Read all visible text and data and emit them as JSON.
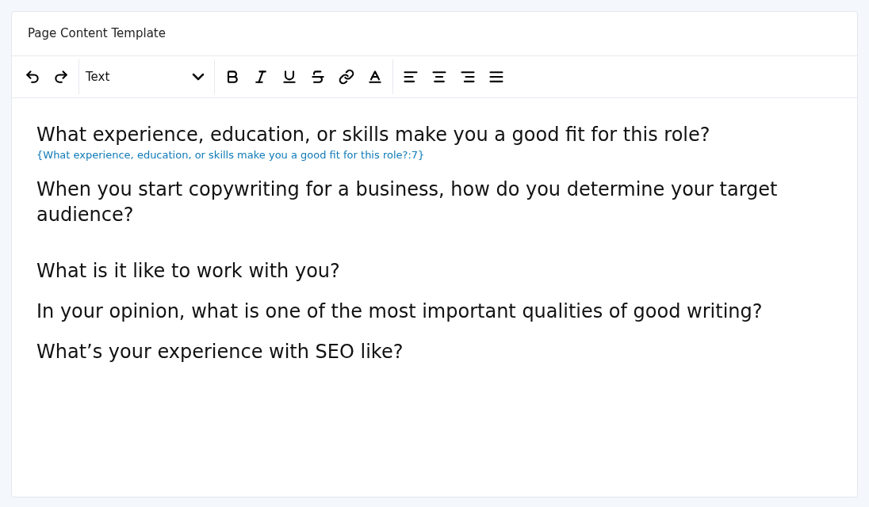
{
  "card": {
    "title": "Page Content Template"
  },
  "toolbar": {
    "format_select": {
      "value": "Text"
    }
  },
  "content": [
    {
      "kind": "paragraph",
      "text": "What experience, education, or skills make you a good fit for this role?"
    },
    {
      "kind": "tag",
      "text": "{What experience, education, or skills make you a good fit for this role?:7}"
    },
    {
      "kind": "paragraph",
      "text": "When you start copywriting for a business, how do you determine your target audience?"
    },
    {
      "kind": "empty"
    },
    {
      "kind": "paragraph",
      "text": "What is it like to work with you?"
    },
    {
      "kind": "paragraph",
      "text": "In your opinion, what is one of the most important qualities of good writing?"
    },
    {
      "kind": "paragraph",
      "text": "What’s your experience with SEO like?"
    }
  ]
}
